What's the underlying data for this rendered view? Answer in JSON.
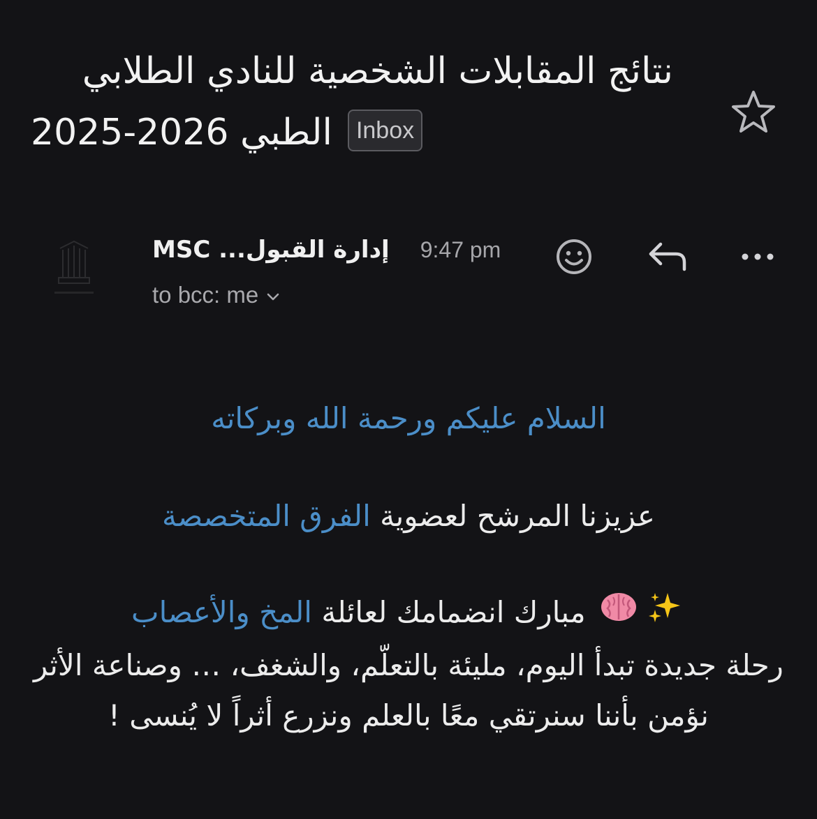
{
  "email": {
    "subject_line1": "نتائج المقابلات الشخصية للنادي الطلابي",
    "subject_line2_word": "الطبي",
    "subject_year": "2025-2026",
    "label": "Inbox",
    "sender_name": "إدارة القبول... MSC",
    "time": "9:47 pm",
    "recipients": "to bcc: me"
  },
  "icons": {
    "star": "star-outline-icon",
    "emoji": "smiley-icon",
    "reply": "reply-arrow-icon",
    "more": "ellipsis-icon",
    "expand": "chevron-down-icon",
    "sparkles": "sparkles-emoji",
    "brain": "brain-emoji"
  },
  "body": {
    "greeting": "السلام عليكم ورحمة الله وبركاته",
    "salutation_pre": "عزيزنا المرشح لعضوية ",
    "salutation_link": "الفرق المتخصصة",
    "congrats_pre": "مبارك انضمامك لعائلة ",
    "congrats_link": "المخ والأعصاب",
    "journey": "رحلة جديدة تبدأ اليوم، مليئة بالتعلّم، والشغف، … وصناعة الأثر",
    "belief": "نؤمن بأننا سنرتقي معًا بالعلم ونزرع أثراً لا يُنسى !"
  },
  "colors": {
    "background": "#131316",
    "link_blue": "#4b8ec8",
    "text": "#ececec",
    "muted": "#a6a6aa"
  }
}
